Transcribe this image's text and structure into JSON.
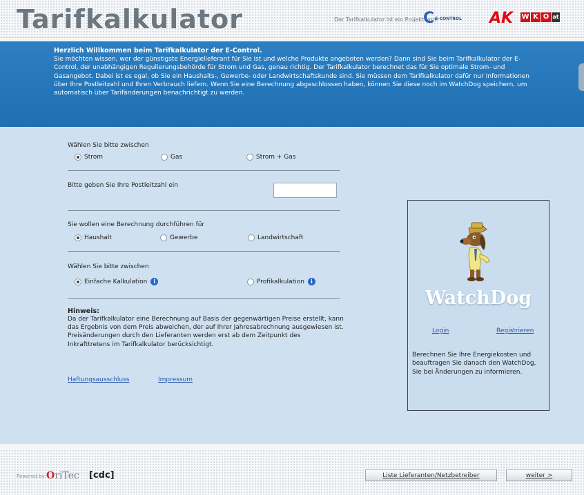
{
  "header": {
    "title": "Tarifkalkulator",
    "project_note": "Der Tarifkalkulator ist ein Projekt von:",
    "logos": {
      "econtrol": "E-CONTROL",
      "ak": "AK",
      "wko": [
        "W",
        "K",
        "O",
        "at"
      ]
    }
  },
  "welcome": {
    "title": "Herzlich Willkommen beim Tarifkalkulator der E-Control.",
    "body": "Sie möchten wissen, wer der günstigste Energielieferant für Sie ist und welche Produkte angeboten werden? Dann sind Sie beim Tarifkalkulator der E-Control, der unabhängigen Regulierungsbehörde für Strom und Gas, genau richtig. Der Tarifkalkulator berechnet das für Sie optimale Strom- und Gasangebot. Dabei ist es egal, ob Sie ein Haushalts-, Gewerbe- oder Landwirtschaftskunde sind. Sie müssen dem Tarifkalkulator dafür nur Informationen über Ihre Postleitzahl und Ihren Verbrauch liefern. Wenn Sie eine Berechnung abgeschlossen haben, können Sie diese noch im WatchDog speichern, um automatisch über Tarifänderungen benachrichtigt zu werden."
  },
  "form": {
    "energy_label": "Wählen Sie bitte zwischen",
    "energy_options": [
      "Strom",
      "Gas",
      "Strom + Gas"
    ],
    "energy_selected": "Strom",
    "plz_label": "Bitte geben Sie Ihre Postleitzahl ein",
    "plz_value": "",
    "customer_label": "Sie wollen eine Berechnung durchführen für",
    "customer_options": [
      "Haushalt",
      "Gewerbe",
      "Landwirtschaft"
    ],
    "customer_selected": "Haushalt",
    "calc_label": "Wählen Sie bitte zwischen",
    "calc_options": [
      "Einfache Kalkulation",
      "Profikalkulation"
    ],
    "calc_selected": "Einfache Kalkulation"
  },
  "hinweis": {
    "title": "Hinweis:",
    "text": "Da der Tarifkalkulator eine Berechnung auf Basis der gegenwärtigen Preise erstellt, kann das Ergebnis von dem Preis abweichen, der auf Ihrer Jahresabrechnung ausgewiesen ist. Preisänderungen durch den Lieferanten werden erst ab dem Zeitpunkt des Inkrafttretens im Tarifkalkulator berücksichtigt."
  },
  "links": {
    "haftung": "Haftungsausschluss",
    "impressum": "Impressum"
  },
  "watchdog": {
    "title": "WatchDog",
    "login": "Login",
    "register": "Registrieren",
    "description": "Berechnen Sie Ihre Energiekosten und beauftragen Sie danach den WatchDog, Sie bei Änderungen zu informieren."
  },
  "footer": {
    "powered_by": "Powered by:",
    "oritec": "Oritec",
    "cdc": "[cdc]",
    "liste_button": "Liste Lieferanten/Netzbetreiber",
    "weiter_button": "weiter >"
  }
}
